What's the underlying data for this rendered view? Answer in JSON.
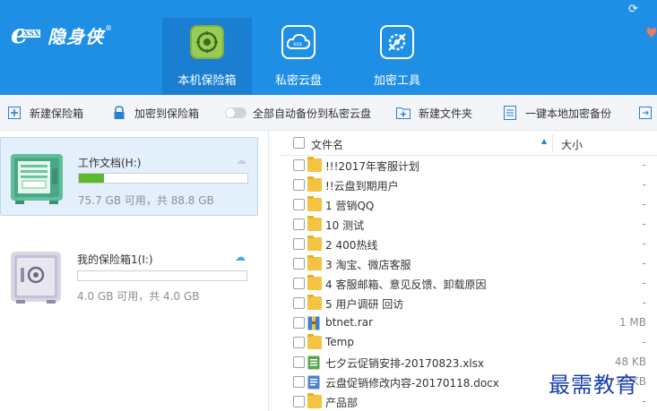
{
  "app": {
    "logo_badge": "XSX",
    "logo_text": "隐身侠",
    "logo_reg": "®"
  },
  "nav": {
    "tabs": [
      {
        "label": "本机保险箱",
        "icon": "vault-icon",
        "active": true
      },
      {
        "label": "私密云盘",
        "icon": "cloud-icon",
        "active": false
      },
      {
        "label": "加密工具",
        "icon": "tools-icon",
        "active": false
      }
    ]
  },
  "toolbar": {
    "new_vault": "新建保险箱",
    "encrypt_to_vault": "加密到保险箱",
    "auto_backup": "全部自动备份到私密云盘",
    "new_folder": "新建文件夹",
    "one_click_backup": "一键本地加密备份"
  },
  "vaults": [
    {
      "name": "工作文档(H:)",
      "size": "75.7 GB 可用，共 88.8 GB",
      "used_fraction": 0.147,
      "selected": true
    },
    {
      "name": "我的保险箱1(I:)",
      "size": "4.0 GB 可用，共 4.0 GB",
      "used_fraction": 0.0,
      "selected": false
    }
  ],
  "filelist": {
    "col_name": "文件名",
    "col_size": "大小",
    "rows": [
      {
        "name": "!!!2017年客服计划",
        "type": "folder",
        "size": "-"
      },
      {
        "name": "!!云盘到期用户",
        "type": "folder",
        "size": "-"
      },
      {
        "name": "1 营销QQ",
        "type": "folder",
        "size": "-"
      },
      {
        "name": "10 测试",
        "type": "folder",
        "size": "-"
      },
      {
        "name": "2 400热线",
        "type": "folder",
        "size": "-"
      },
      {
        "name": "3 淘宝、微店客服",
        "type": "folder",
        "size": "-"
      },
      {
        "name": "4 客服邮箱、意见反馈、卸载原因",
        "type": "folder",
        "size": "-"
      },
      {
        "name": "5 用户调研 回访",
        "type": "folder",
        "size": "-"
      },
      {
        "name": "btnet.rar",
        "type": "rar",
        "size": "1 MB"
      },
      {
        "name": "Temp",
        "type": "folder",
        "size": "-"
      },
      {
        "name": "七夕云促销安排-20170823.xlsx",
        "type": "xlsx",
        "size": "48 KB"
      },
      {
        "name": "云盘促销修改内容-20170118.docx",
        "type": "docx",
        "size": "13 KB"
      },
      {
        "name": "产品部",
        "type": "folder",
        "size": "-"
      }
    ]
  },
  "watermark": "最需教育",
  "colors": {
    "header": "#1f8fe6",
    "active_tab": "#1a7fd1",
    "progress": "#5cb92c",
    "folder": "#f5c342"
  }
}
